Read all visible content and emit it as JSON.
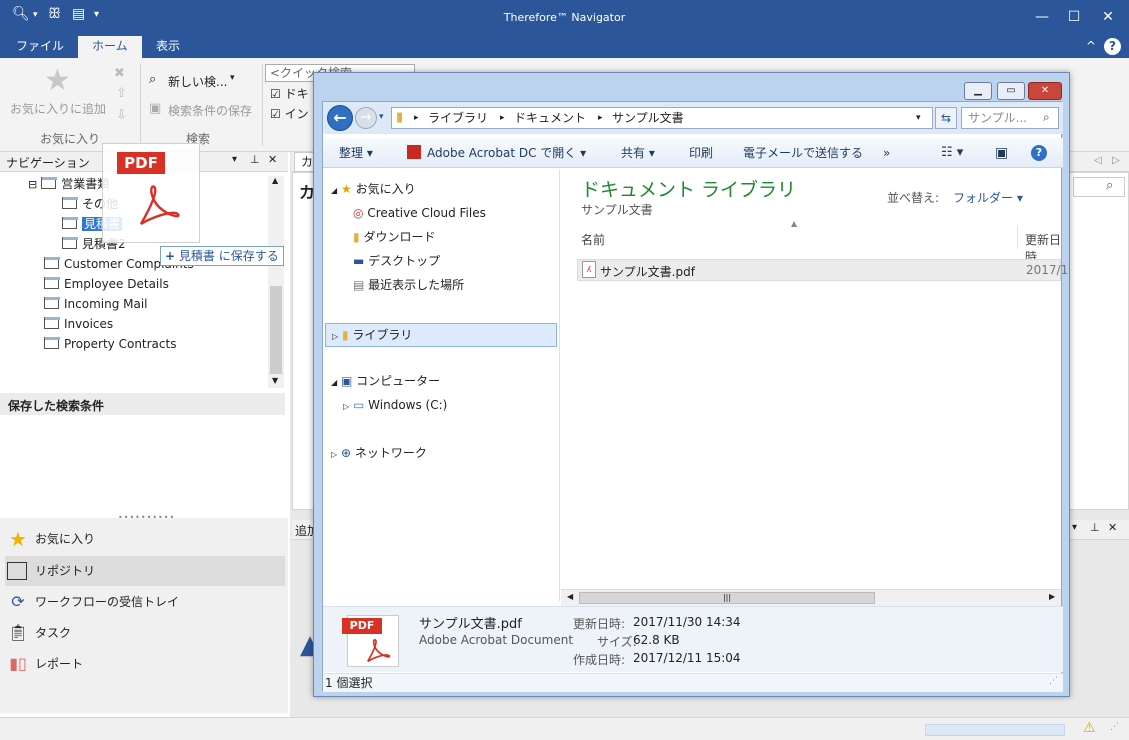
{
  "app": {
    "title": "Therefore™ Navigator"
  },
  "ribbon_tabs": [
    "ファイル",
    "ホーム",
    "表示"
  ],
  "ribbon": {
    "favorites_add": "お気に入りに追加",
    "favorites_group": "お気に入り",
    "new_search": "新しい検...",
    "save_search": "検索条件の保存",
    "search_group": "検索",
    "quick_search_placeholder": "<クイック検索",
    "check1": "ドキ",
    "check2": "イン"
  },
  "navigation": {
    "header": "ナビゲーション",
    "tree": [
      {
        "label": "営業書類",
        "level": 0,
        "expander": "⊟"
      },
      {
        "label": "その他",
        "level": 1
      },
      {
        "label": "見積書",
        "level": 1,
        "selected": true
      },
      {
        "label": "見積書2",
        "level": 1
      },
      {
        "label": "Customer Complaints",
        "level": 0
      },
      {
        "label": "Employee Details",
        "level": 0
      },
      {
        "label": "Incoming Mail",
        "level": 0
      },
      {
        "label": "Invoices",
        "level": 0
      },
      {
        "label": "Property Contracts",
        "level": 0
      }
    ],
    "saved_searches_header": "保存した検索条件",
    "bottom_items": [
      {
        "label": "お気に入り",
        "icon": "star-icon"
      },
      {
        "label": "リポジトリ",
        "icon": "repository-icon"
      },
      {
        "label": "ワークフローの受信トレイ",
        "icon": "workflow-icon"
      },
      {
        "label": "タスク",
        "icon": "task-icon"
      },
      {
        "label": "レポート",
        "icon": "report-icon"
      }
    ]
  },
  "drag": {
    "badge": "PDF",
    "tooltip_prefix": "+",
    "tooltip": "見積書 に保存する"
  },
  "main": {
    "tab_fragment": "カ",
    "heading_fragment": "カ",
    "add_fragment": "追加"
  },
  "explorer": {
    "breadcrumb": [
      "ライブラリ",
      "ドキュメント",
      "サンプル文書"
    ],
    "search_placeholder": "サンプル...",
    "commands": [
      "整理",
      "Adobe Acrobat DC で開く",
      "共有",
      "印刷",
      "電子メールで送信する",
      "»"
    ],
    "nav": {
      "favorites": "お気に入り",
      "favorites_items": [
        "Creative Cloud Files",
        "ダウンロード",
        "デスクトップ",
        "最近表示した場所"
      ],
      "libraries": "ライブラリ",
      "computer": "コンピューター",
      "drive": "Windows (C:)",
      "network": "ネットワーク"
    },
    "library_title": "ドキュメント ライブラリ",
    "library_subtitle": "サンプル文書",
    "arrange_label": "並べ替え:",
    "arrange_value": "フォルダー",
    "columns": [
      "名前",
      "更新日時"
    ],
    "files": [
      {
        "name": "サンプル文書.pdf",
        "date": "2017/1"
      }
    ],
    "details": {
      "name": "サンプル文書.pdf",
      "type": "Adobe Acrobat Document",
      "modified_label": "更新日時:",
      "modified": "2017/11/30 14:34",
      "size_label": "サイズ:",
      "size": "62.8 KB",
      "created_label": "作成日時:",
      "created": "2017/12/11 15:04"
    },
    "status": "1 個選択",
    "badge": "PDF"
  },
  "colors": {
    "accent": "#2b579a",
    "library_title": "#1e8a2e",
    "pdf_red": "#d93025"
  }
}
